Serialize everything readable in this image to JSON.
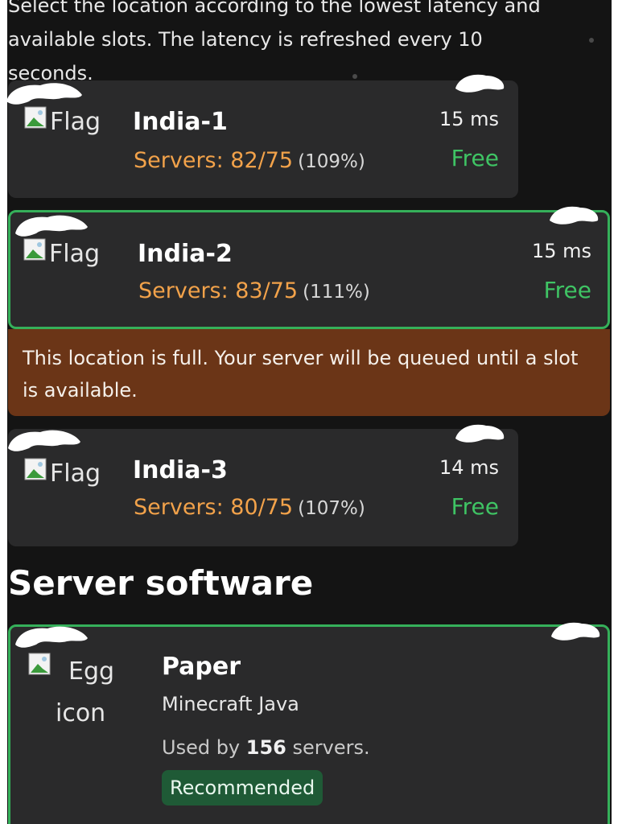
{
  "intro": {
    "line1": "Select the location according to the lowest latency and",
    "line2": "available slots. The latency is refreshed every 10",
    "line3": "seconds."
  },
  "locations": [
    {
      "flag_alt": "Flag",
      "name": "India-1",
      "servers_label": "Servers: 82/75",
      "percent": "(109%)",
      "latency": "15 ms",
      "status": "Free"
    },
    {
      "flag_alt": "Flag",
      "name": "India-2",
      "servers_label": "Servers: 83/75",
      "percent": "(111%)",
      "latency": "15 ms",
      "status": "Free"
    },
    {
      "flag_alt": "Flag",
      "name": "India-3",
      "servers_label": "Servers: 80/75",
      "percent": "(107%)",
      "latency": "14 ms",
      "status": "Free"
    }
  ],
  "selected_location": "India-2",
  "full_notice": "This location is full. Your server will be queued until a slot is available.",
  "software_section": {
    "title": "Server software",
    "card": {
      "icon_alt_line1": "Egg",
      "icon_alt_line2": "icon",
      "name": "Paper",
      "game": "Minecraft Java",
      "used_prefix": "Used by",
      "used_count": "156",
      "used_suffix": "servers.",
      "badge": "Recommended"
    }
  },
  "colors": {
    "background": "#141414",
    "card": "#2a2a2b",
    "accent_green": "#35b05a",
    "free_green": "#3fc464",
    "servers_orange": "#f2a24a",
    "notice_brown": "#6b3517",
    "badge_green": "#1f5a36"
  },
  "icons": {
    "flag": "broken-image-icon",
    "egg": "broken-image-icon",
    "snow": "snow-cap-decoration"
  }
}
